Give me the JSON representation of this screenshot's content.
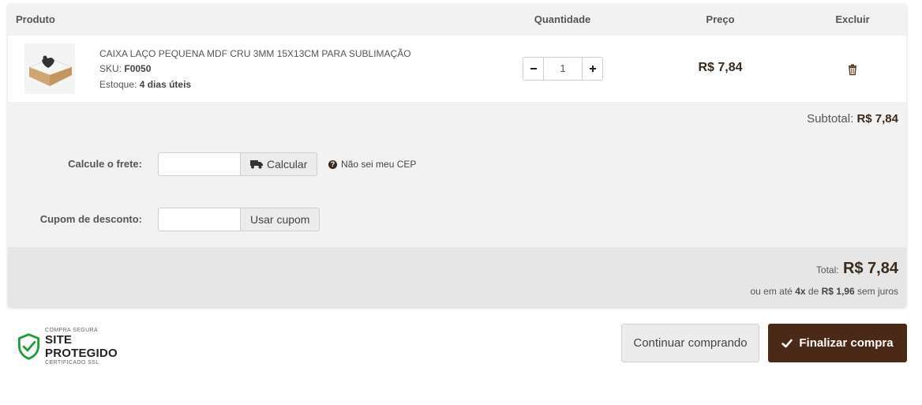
{
  "colors": {
    "brand": "#4a2a16",
    "price": "#3a2a1c",
    "badge_green": "#1d9e3a"
  },
  "table": {
    "headers": {
      "product": "Produto",
      "quantity": "Quantidade",
      "price": "Preço",
      "remove": "Excluir"
    }
  },
  "item": {
    "name": "CAIXA LAÇO PEQUENA MDF CRU 3MM 15X13CM PARA SUBLIMAÇÃO",
    "sku_label": "SKU:",
    "sku": "F0050",
    "stock_label": "Estoque:",
    "stock": "4 dias úteis",
    "quantity": "1",
    "price": "R$ 7,84",
    "thumbnail_icon": "product-thumbnail",
    "remove_icon": "trash-icon"
  },
  "subtotal": {
    "label": "Subtotal:",
    "value": "R$ 7,84"
  },
  "shipping": {
    "label": "Calcule o frete:",
    "value": "",
    "button": "Calcular",
    "button_icon": "truck-icon",
    "help": "Não sei meu CEP"
  },
  "coupon": {
    "label": "Cupom de desconto:",
    "value": "",
    "button": "Usar cupom"
  },
  "total": {
    "label": "Total:",
    "value": "R$ 7,84",
    "installment_prefix": "ou em até",
    "installment_count": "4x",
    "installment_mid": "de",
    "installment_value": "R$ 1,96",
    "installment_suffix": "sem juros"
  },
  "security_badge": {
    "small_top": "COMPRA SEGURA",
    "title": "SITE PROTEGIDO",
    "small_bottom": "CERTIFICADO SSL"
  },
  "actions": {
    "continue": "Continuar comprando",
    "finalize": "Finalizar compra"
  }
}
